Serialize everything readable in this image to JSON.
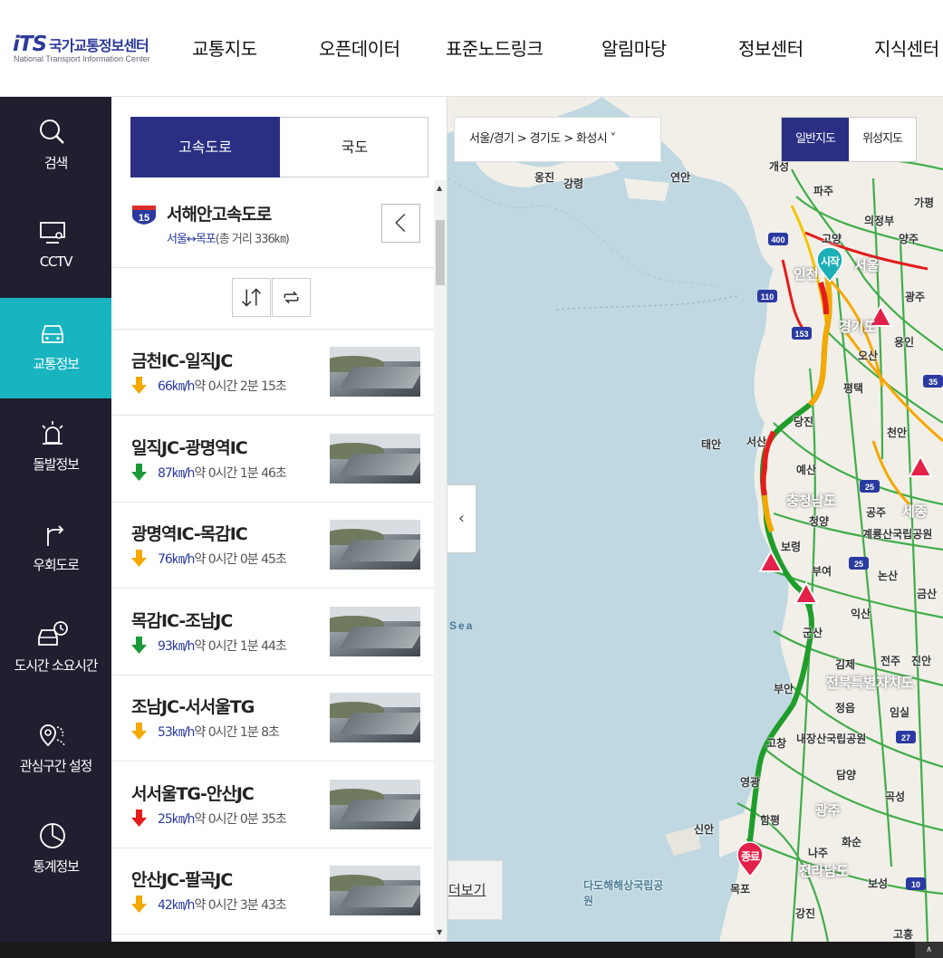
{
  "header": {
    "logo_mark": "iTS",
    "logo_ko": "국가교통정보센터",
    "logo_en": "National Transport Information Center",
    "nav": [
      "교통지도",
      "오픈데이터",
      "표준노드링크",
      "알림마당",
      "정보센터",
      "지식센터"
    ]
  },
  "rail": [
    {
      "label": "검색",
      "icon": "search-icon"
    },
    {
      "label": "CCTV",
      "icon": "cctv-icon"
    },
    {
      "label": "교통정보",
      "icon": "car-icon",
      "active": true
    },
    {
      "label": "돌발정보",
      "icon": "siren-icon"
    },
    {
      "label": "우회도로",
      "icon": "detour-icon"
    },
    {
      "label": "도시간 소요시간",
      "icon": "car-clock-icon"
    },
    {
      "label": "관심구간 설정",
      "icon": "location-pin-icon"
    },
    {
      "label": "통계정보",
      "icon": "chart-icon"
    }
  ],
  "panel": {
    "tabs": [
      "고속도로",
      "국도"
    ],
    "route": {
      "number": "15",
      "name": "서해안고속도로",
      "origin_dest": "서울↔목포",
      "distance": "(총 거리 336㎞)"
    },
    "sections": [
      {
        "name": "금천IC-일직JC",
        "speed": "66",
        "unit": "㎞/h",
        "time": "약 0시간 2분 15초",
        "trend": "down",
        "color": "#f5a800"
      },
      {
        "name": "일직JC-광명역IC",
        "speed": "87",
        "unit": "㎞/h",
        "time": "약 0시간 1분 46초",
        "trend": "down",
        "color": "#1a9a3a"
      },
      {
        "name": "광명역IC-목감IC",
        "speed": "76",
        "unit": "㎞/h",
        "time": "약 0시간 0분 45초",
        "trend": "down",
        "color": "#f5a800"
      },
      {
        "name": "목감IC-조남JC",
        "speed": "93",
        "unit": "㎞/h",
        "time": "약 0시간 1분 44초",
        "trend": "down",
        "color": "#1a9a3a"
      },
      {
        "name": "조남JC-서서울TG",
        "speed": "53",
        "unit": "㎞/h",
        "time": "약 0시간 1분 8초",
        "trend": "down",
        "color": "#f5a800"
      },
      {
        "name": "서서울TG-안산JC",
        "speed": "25",
        "unit": "㎞/h",
        "time": "약 0시간 0분 35초",
        "trend": "down",
        "color": "#e31d1d"
      },
      {
        "name": "안산JC-팔곡JC",
        "speed": "42",
        "unit": "㎞/h",
        "time": "약 0시간 3분 43초",
        "trend": "down",
        "color": "#f5a800"
      }
    ]
  },
  "map": {
    "breadcrumb": "서울/경기 > 경기도 > 화성시 ˅",
    "view_buttons": [
      "일반지도",
      "위성지도"
    ],
    "more": "더보기",
    "sea": "Sea",
    "start_label": "시작",
    "end_label": "종료",
    "places": [
      "개성",
      "파주",
      "의정부",
      "고양",
      "양주",
      "인천",
      "서울",
      "광주",
      "경기도",
      "용인",
      "오산",
      "평택",
      "당진",
      "천안",
      "태안",
      "서산",
      "예산",
      "충청남도",
      "공주",
      "세종",
      "청양",
      "계룡산국립공원",
      "보령",
      "부여",
      "논산",
      "군산",
      "익산",
      "김제",
      "전주",
      "전북특별자치도",
      "부안",
      "정읍",
      "내장산국립공원",
      "고창",
      "담양",
      "영광",
      "광주",
      "함평",
      "나주",
      "신안",
      "화순",
      "전라남도",
      "목포",
      "보성",
      "강진",
      "다도해해상국립공원",
      "연안",
      "옹진",
      "강령",
      "가평",
      "금산",
      "진안",
      "임실",
      "곡성",
      "고흥"
    ]
  },
  "footer": {
    "top": "∧"
  }
}
